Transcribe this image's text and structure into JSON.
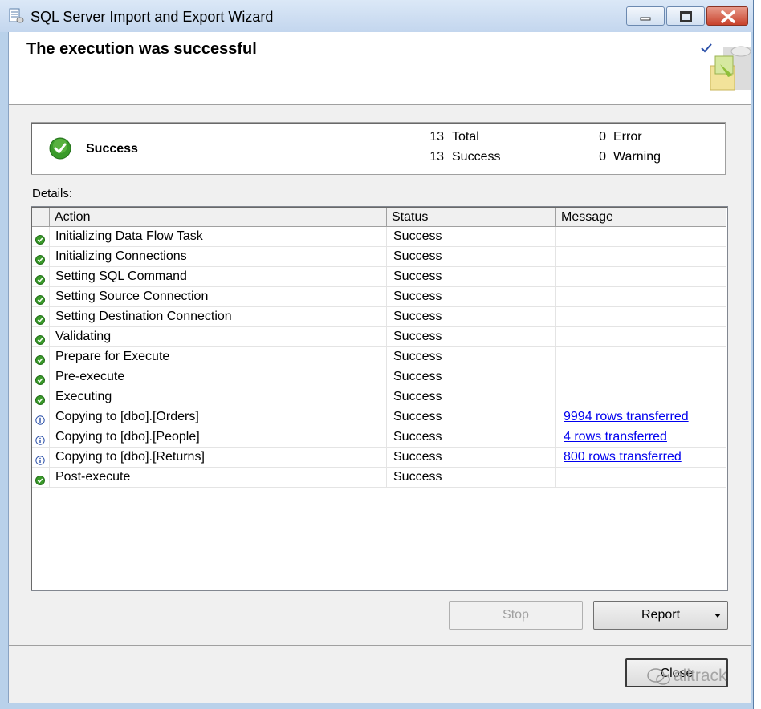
{
  "window": {
    "title": "SQL Server Import and Export Wizard"
  },
  "header": {
    "title": "The execution was successful"
  },
  "summary": {
    "status": "Success",
    "total_count": "13",
    "total_label": "Total",
    "success_count": "13",
    "success_label": "Success",
    "error_count": "0",
    "error_label": "Error",
    "warning_count": "0",
    "warning_label": "Warning"
  },
  "details": {
    "label": "Details:",
    "columns": {
      "action": "Action",
      "status": "Status",
      "message": "Message"
    },
    "rows": [
      {
        "icon": "success-icon",
        "action": "Initializing Data Flow Task",
        "status": "Success",
        "message": ""
      },
      {
        "icon": "success-icon",
        "action": "Initializing Connections",
        "status": "Success",
        "message": ""
      },
      {
        "icon": "success-icon",
        "action": "Setting SQL Command",
        "status": "Success",
        "message": ""
      },
      {
        "icon": "success-icon",
        "action": "Setting Source Connection",
        "status": "Success",
        "message": ""
      },
      {
        "icon": "success-icon",
        "action": "Setting Destination Connection",
        "status": "Success",
        "message": ""
      },
      {
        "icon": "success-icon",
        "action": "Validating",
        "status": "Success",
        "message": ""
      },
      {
        "icon": "success-icon",
        "action": "Prepare for Execute",
        "status": "Success",
        "message": ""
      },
      {
        "icon": "success-icon",
        "action": "Pre-execute",
        "status": "Success",
        "message": ""
      },
      {
        "icon": "success-icon",
        "action": "Executing",
        "status": "Success",
        "message": ""
      },
      {
        "icon": "info-icon",
        "action": "Copying to [dbo].[Orders]",
        "status": "Success",
        "message": "9994 rows transferred"
      },
      {
        "icon": "info-icon",
        "action": "Copying to [dbo].[People]",
        "status": "Success",
        "message": "4 rows transferred"
      },
      {
        "icon": "info-icon",
        "action": "Copying to [dbo].[Returns]",
        "status": "Success",
        "message": "800 rows transferred"
      },
      {
        "icon": "success-icon",
        "action": "Post-execute",
        "status": "Success",
        "message": ""
      }
    ]
  },
  "buttons": {
    "stop": "Stop",
    "report": "Report",
    "close": "Close"
  },
  "watermark": "alltrack",
  "colors": {
    "success_green": "#3a9a2a",
    "info_blue": "#2a4fa8",
    "link": "#0000ee",
    "titlebar": "#c3d6ee"
  }
}
